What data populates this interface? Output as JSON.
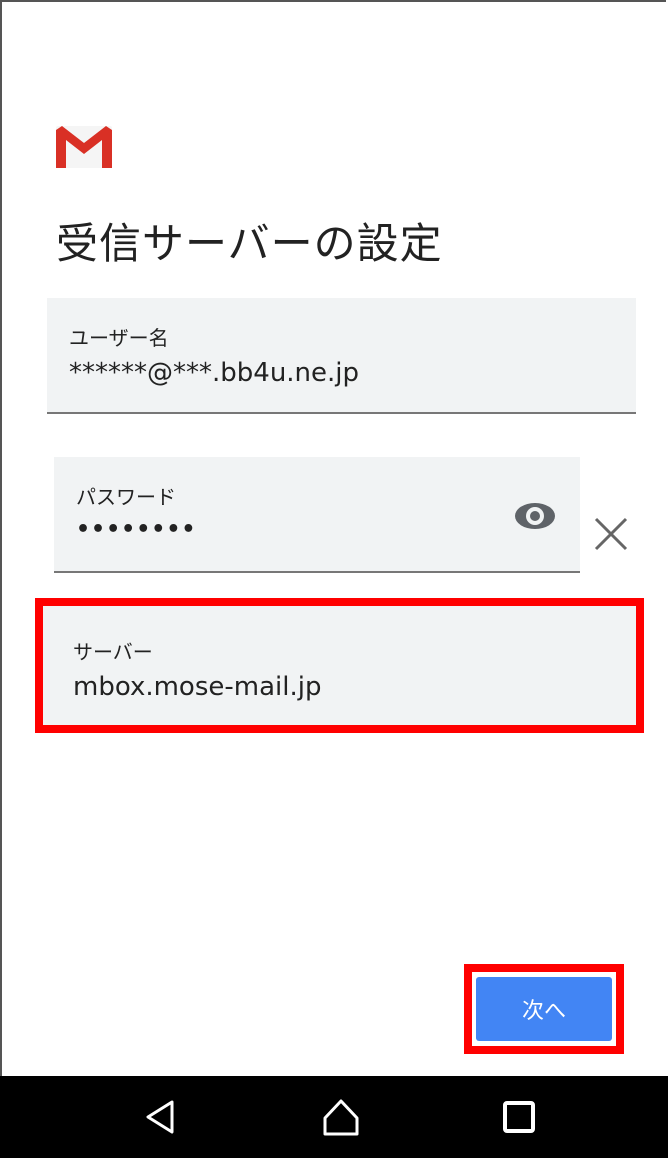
{
  "screen": {
    "title": "受信サーバーの設定",
    "logo_icon": "gmail-logo-icon"
  },
  "fields": {
    "username": {
      "label": "ユーザー名",
      "value": "******@***.bb4u.ne.jp"
    },
    "password": {
      "label": "パスワード",
      "value": "••••••••",
      "toggle_icon": "eye-icon",
      "clear_icon": "close-icon"
    },
    "server": {
      "label": "サーバー",
      "value": "mbox.mose-mail.jp"
    }
  },
  "actions": {
    "next_label": "次へ"
  },
  "navbar": {
    "back_icon": "back-triangle-icon",
    "home_icon": "home-icon",
    "recents_icon": "recents-square-icon"
  },
  "colors": {
    "accent": "#4285f4",
    "highlight": "#ff0000",
    "field_bg": "#f1f3f4",
    "navbar_bg": "#000000"
  }
}
